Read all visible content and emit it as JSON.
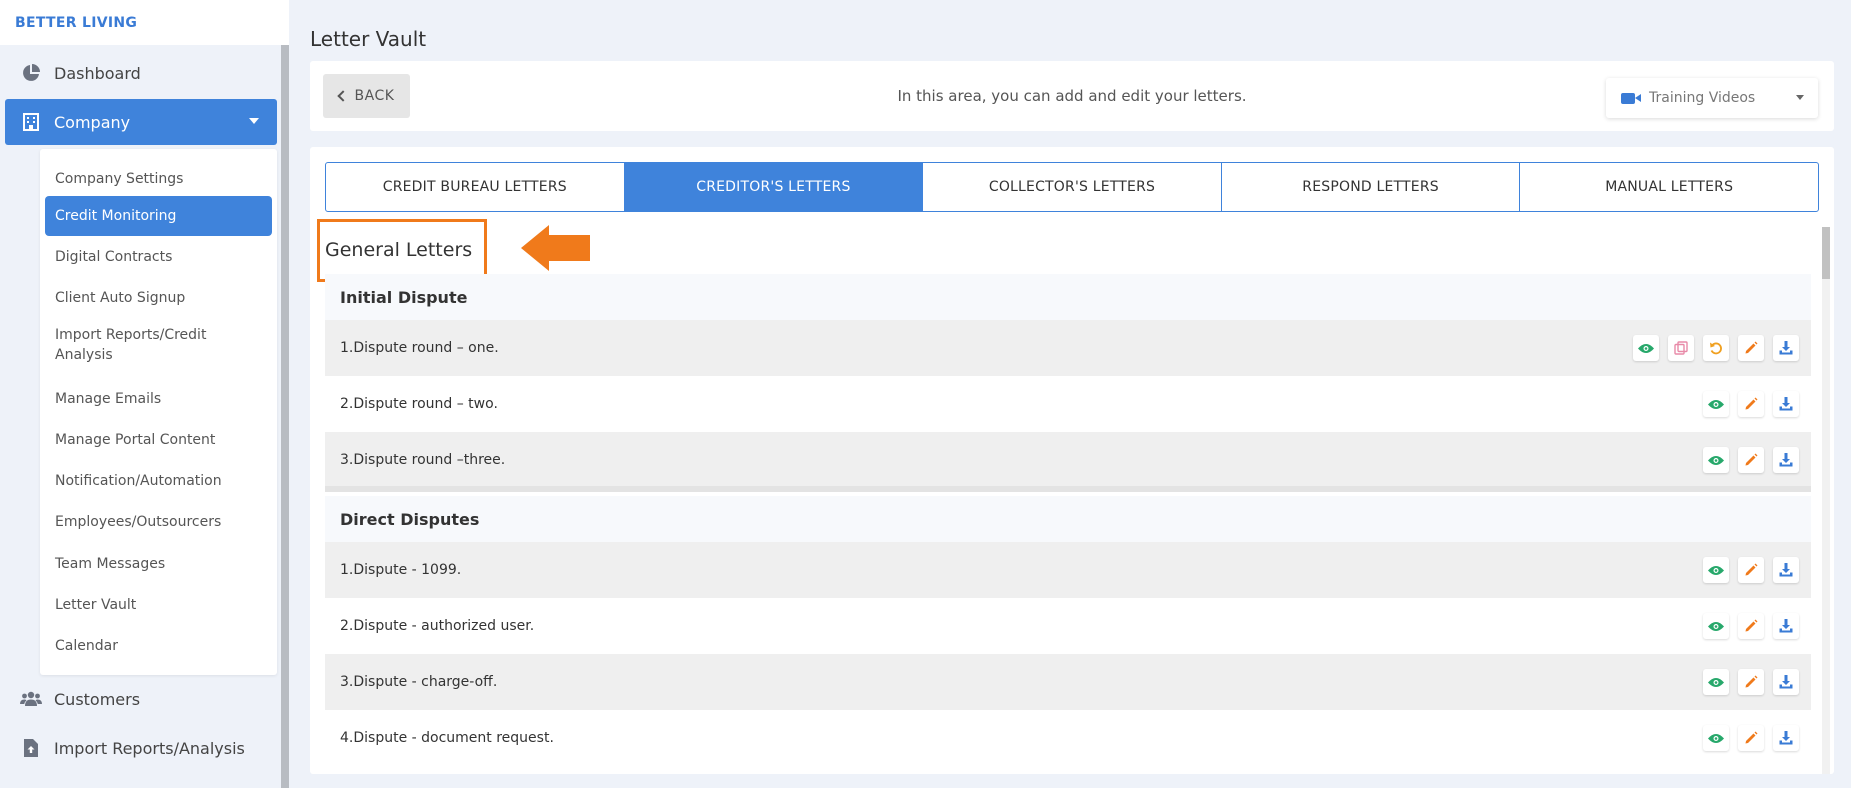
{
  "brand": "BETTER LIVING",
  "page_title": "Letter Vault",
  "sidebar": {
    "items": [
      {
        "label": "Dashboard",
        "icon": "pie-chart-icon"
      },
      {
        "label": "Company",
        "icon": "building-icon"
      },
      {
        "label": "Customers",
        "icon": "users-icon"
      },
      {
        "label": "Import Reports/Analysis",
        "icon": "file-upload-icon"
      }
    ],
    "submenu": [
      "Company Settings",
      "Credit Monitoring",
      "Digital Contracts",
      "Client Auto Signup",
      "Import Reports/Credit Analysis",
      "Manage Emails",
      "Manage Portal Content",
      "Notification/Automation",
      "Employees/Outsourcers",
      "Team Messages",
      "Letter Vault",
      "Calendar"
    ],
    "active_submenu": "Credit Monitoring"
  },
  "toolbar": {
    "back_label": "BACK",
    "info_text": "In this area, you can add and edit your letters.",
    "training_label": "Training Videos"
  },
  "tabs": [
    "CREDIT BUREAU LETTERS",
    "CREDITOR'S LETTERS",
    "COLLECTOR'S LETTERS",
    "RESPOND LETTERS",
    "MANUAL LETTERS"
  ],
  "active_tab": "CREDITOR'S LETTERS",
  "section_title": "General Letters",
  "groups": [
    {
      "title": "Initial Dispute",
      "letters": [
        {
          "name": "1.Dispute round – one.",
          "actions": [
            "eye-icon",
            "copy-icon",
            "undo-icon",
            "pencil-icon",
            "download-icon"
          ]
        },
        {
          "name": "2.Dispute round – two.",
          "actions": [
            "eye-icon",
            "pencil-icon",
            "download-icon"
          ]
        },
        {
          "name": "3.Dispute round –three.",
          "actions": [
            "eye-icon",
            "pencil-icon",
            "download-icon"
          ]
        }
      ]
    },
    {
      "title": "Direct Disputes",
      "letters": [
        {
          "name": "1.Dispute - 1099.",
          "actions": [
            "eye-icon",
            "pencil-icon",
            "download-icon"
          ]
        },
        {
          "name": "2.Dispute - authorized user.",
          "actions": [
            "eye-icon",
            "pencil-icon",
            "download-icon"
          ]
        },
        {
          "name": "3.Dispute - charge-off.",
          "actions": [
            "eye-icon",
            "pencil-icon",
            "download-icon"
          ]
        },
        {
          "name": "4.Dispute - document request.",
          "actions": [
            "eye-icon",
            "pencil-icon",
            "download-icon"
          ]
        }
      ]
    }
  ],
  "colors": {
    "primary": "#3f83db",
    "highlight": "#f07a1b",
    "eye": "#27a86b",
    "pencil": "#f07a1b",
    "download": "#3a7bd5",
    "copy": "#e88aa8",
    "undo": "#f0a020"
  }
}
